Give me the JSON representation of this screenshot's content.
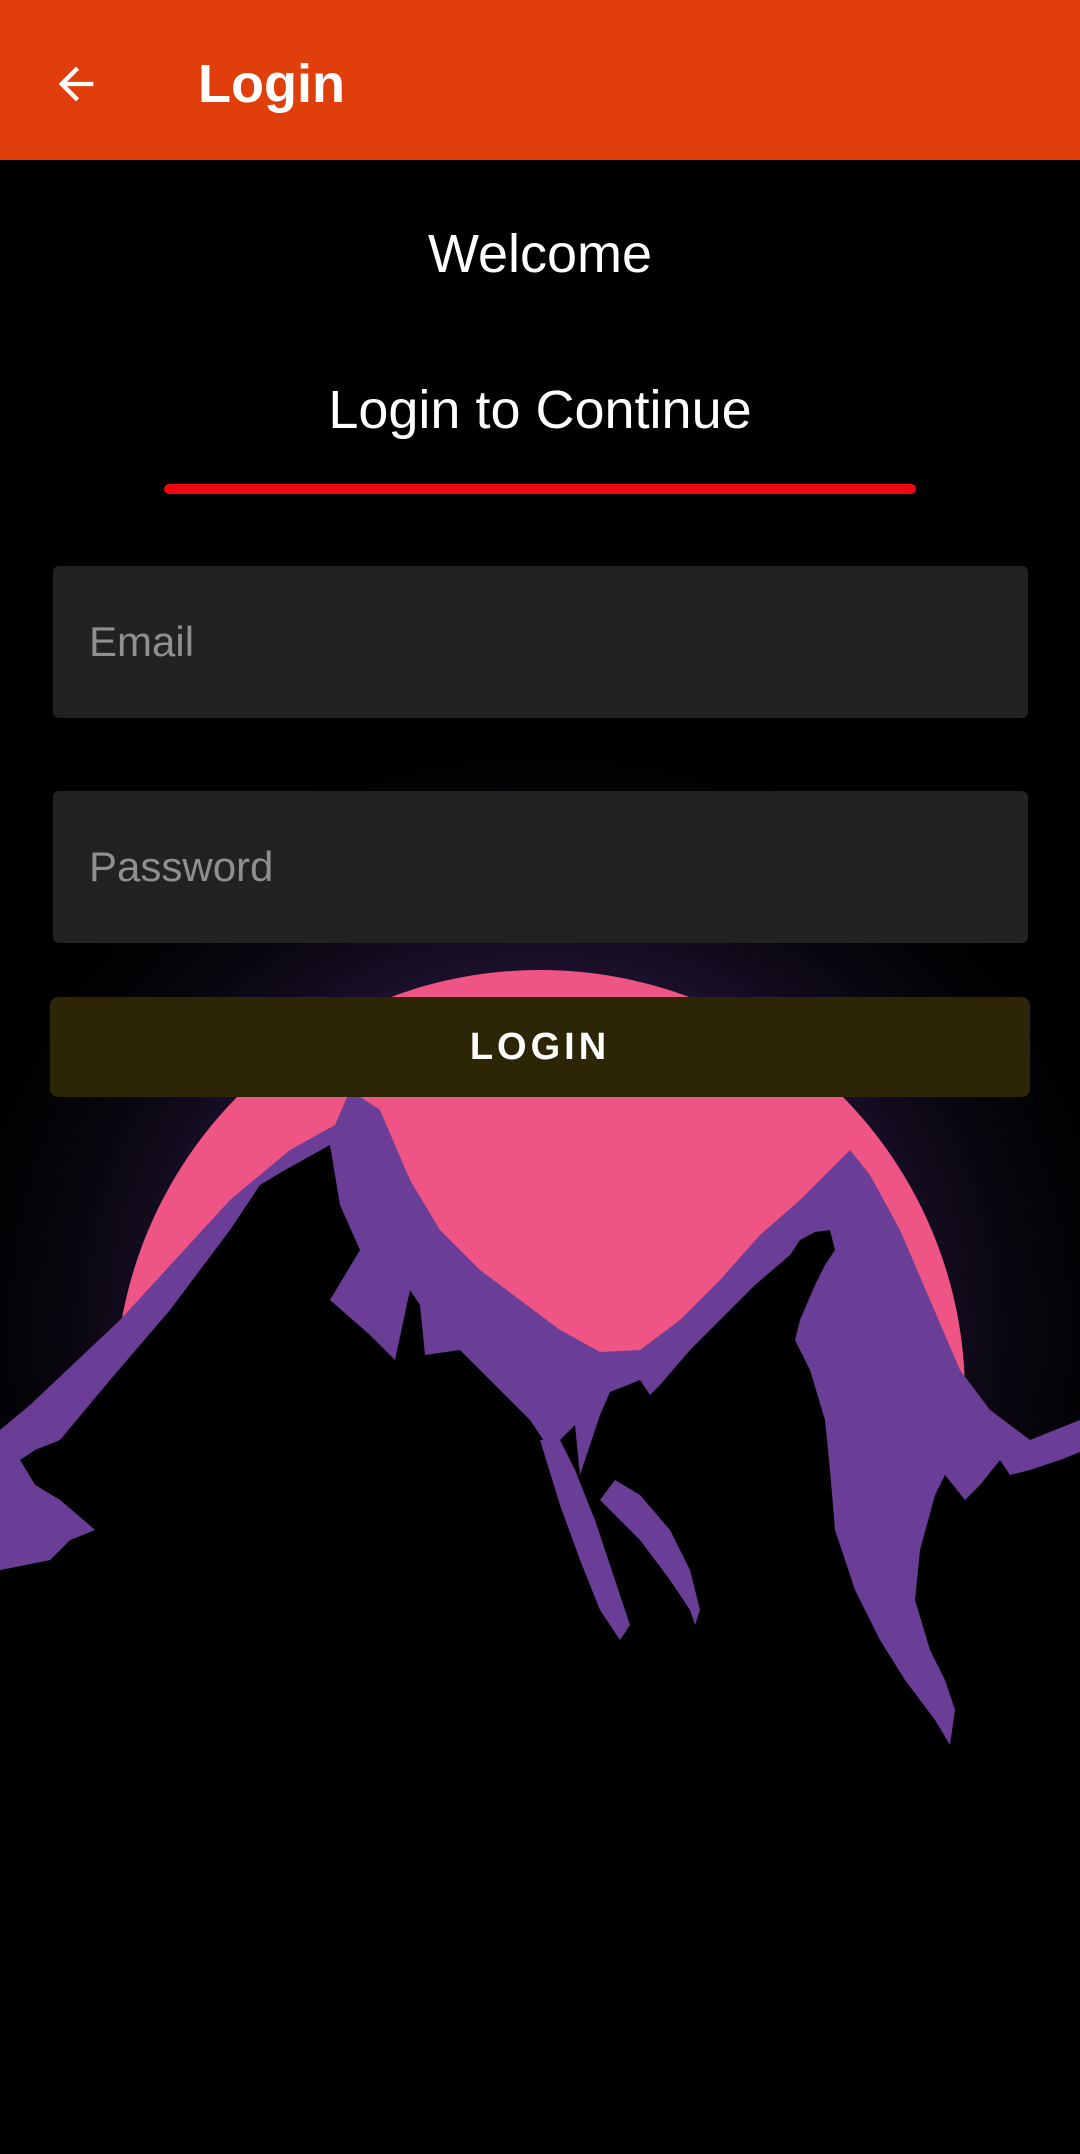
{
  "appbar": {
    "title": "Login",
    "back_icon": "arrow-left-icon",
    "color": "#E03E0A"
  },
  "welcome": "Welcome",
  "subtitle": "Login to Continue",
  "accent_line_color": "#F0070F",
  "form": {
    "email": {
      "placeholder": "Email",
      "value": ""
    },
    "password": {
      "placeholder": "Password",
      "value": ""
    },
    "login_label": "LOGIN"
  },
  "background": {
    "sun_color": "#EE5585",
    "mountain_color": "#6A3E96",
    "glow_color": "#3A2454"
  }
}
